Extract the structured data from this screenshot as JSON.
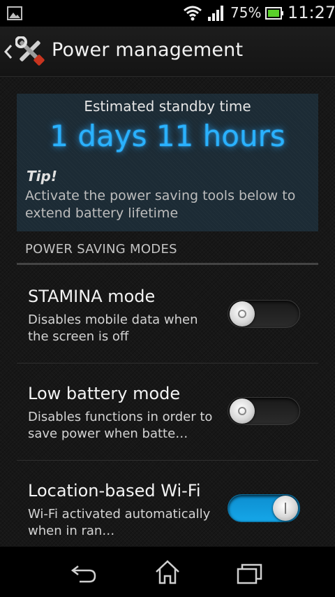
{
  "status_bar": {
    "battery_percent": "75%",
    "time": "11:27",
    "icons": [
      "image-notification-icon",
      "wifi-icon",
      "signal-icon",
      "battery-charging-icon"
    ]
  },
  "action_bar": {
    "title": "Power management",
    "icon": "tools-icon"
  },
  "info_panel": {
    "standby_label": "Estimated standby time",
    "standby_value": "1 days 11 hours",
    "tip_heading": "Tip!",
    "tip_text": "Activate the power saving tools below to extend battery lifetime"
  },
  "section": {
    "header": "POWER SAVING MODES"
  },
  "settings": [
    {
      "title": "STAMINA mode",
      "description": "Disables mobile data when the screen is off",
      "enabled": false
    },
    {
      "title": "Low battery mode",
      "description": "Disables functions in order to save power when batte…",
      "enabled": false
    },
    {
      "title": "Location-based Wi-Fi",
      "description": "Wi-Fi activated automatically when in ran…",
      "enabled": true
    }
  ],
  "colors": {
    "accent": "#2ab2ff",
    "toggle_on": "#15a6e8",
    "panel_bg": "#1c2b35"
  },
  "nav_bar": {
    "icons": [
      "back-icon",
      "home-icon",
      "recent-apps-icon"
    ]
  }
}
